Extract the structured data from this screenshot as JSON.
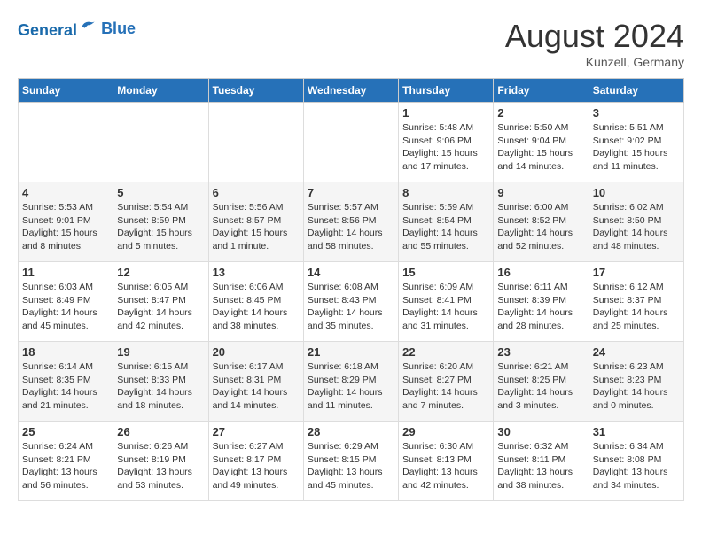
{
  "header": {
    "logo_line1": "General",
    "logo_line2": "Blue",
    "month_title": "August 2024",
    "location": "Kunzell, Germany"
  },
  "weekdays": [
    "Sunday",
    "Monday",
    "Tuesday",
    "Wednesday",
    "Thursday",
    "Friday",
    "Saturday"
  ],
  "weeks": [
    [
      {
        "day": "",
        "info": ""
      },
      {
        "day": "",
        "info": ""
      },
      {
        "day": "",
        "info": ""
      },
      {
        "day": "",
        "info": ""
      },
      {
        "day": "1",
        "info": "Sunrise: 5:48 AM\nSunset: 9:06 PM\nDaylight: 15 hours\nand 17 minutes."
      },
      {
        "day": "2",
        "info": "Sunrise: 5:50 AM\nSunset: 9:04 PM\nDaylight: 15 hours\nand 14 minutes."
      },
      {
        "day": "3",
        "info": "Sunrise: 5:51 AM\nSunset: 9:02 PM\nDaylight: 15 hours\nand 11 minutes."
      }
    ],
    [
      {
        "day": "4",
        "info": "Sunrise: 5:53 AM\nSunset: 9:01 PM\nDaylight: 15 hours\nand 8 minutes."
      },
      {
        "day": "5",
        "info": "Sunrise: 5:54 AM\nSunset: 8:59 PM\nDaylight: 15 hours\nand 5 minutes."
      },
      {
        "day": "6",
        "info": "Sunrise: 5:56 AM\nSunset: 8:57 PM\nDaylight: 15 hours\nand 1 minute."
      },
      {
        "day": "7",
        "info": "Sunrise: 5:57 AM\nSunset: 8:56 PM\nDaylight: 14 hours\nand 58 minutes."
      },
      {
        "day": "8",
        "info": "Sunrise: 5:59 AM\nSunset: 8:54 PM\nDaylight: 14 hours\nand 55 minutes."
      },
      {
        "day": "9",
        "info": "Sunrise: 6:00 AM\nSunset: 8:52 PM\nDaylight: 14 hours\nand 52 minutes."
      },
      {
        "day": "10",
        "info": "Sunrise: 6:02 AM\nSunset: 8:50 PM\nDaylight: 14 hours\nand 48 minutes."
      }
    ],
    [
      {
        "day": "11",
        "info": "Sunrise: 6:03 AM\nSunset: 8:49 PM\nDaylight: 14 hours\nand 45 minutes."
      },
      {
        "day": "12",
        "info": "Sunrise: 6:05 AM\nSunset: 8:47 PM\nDaylight: 14 hours\nand 42 minutes."
      },
      {
        "day": "13",
        "info": "Sunrise: 6:06 AM\nSunset: 8:45 PM\nDaylight: 14 hours\nand 38 minutes."
      },
      {
        "day": "14",
        "info": "Sunrise: 6:08 AM\nSunset: 8:43 PM\nDaylight: 14 hours\nand 35 minutes."
      },
      {
        "day": "15",
        "info": "Sunrise: 6:09 AM\nSunset: 8:41 PM\nDaylight: 14 hours\nand 31 minutes."
      },
      {
        "day": "16",
        "info": "Sunrise: 6:11 AM\nSunset: 8:39 PM\nDaylight: 14 hours\nand 28 minutes."
      },
      {
        "day": "17",
        "info": "Sunrise: 6:12 AM\nSunset: 8:37 PM\nDaylight: 14 hours\nand 25 minutes."
      }
    ],
    [
      {
        "day": "18",
        "info": "Sunrise: 6:14 AM\nSunset: 8:35 PM\nDaylight: 14 hours\nand 21 minutes."
      },
      {
        "day": "19",
        "info": "Sunrise: 6:15 AM\nSunset: 8:33 PM\nDaylight: 14 hours\nand 18 minutes."
      },
      {
        "day": "20",
        "info": "Sunrise: 6:17 AM\nSunset: 8:31 PM\nDaylight: 14 hours\nand 14 minutes."
      },
      {
        "day": "21",
        "info": "Sunrise: 6:18 AM\nSunset: 8:29 PM\nDaylight: 14 hours\nand 11 minutes."
      },
      {
        "day": "22",
        "info": "Sunrise: 6:20 AM\nSunset: 8:27 PM\nDaylight: 14 hours\nand 7 minutes."
      },
      {
        "day": "23",
        "info": "Sunrise: 6:21 AM\nSunset: 8:25 PM\nDaylight: 14 hours\nand 3 minutes."
      },
      {
        "day": "24",
        "info": "Sunrise: 6:23 AM\nSunset: 8:23 PM\nDaylight: 14 hours\nand 0 minutes."
      }
    ],
    [
      {
        "day": "25",
        "info": "Sunrise: 6:24 AM\nSunset: 8:21 PM\nDaylight: 13 hours\nand 56 minutes."
      },
      {
        "day": "26",
        "info": "Sunrise: 6:26 AM\nSunset: 8:19 PM\nDaylight: 13 hours\nand 53 minutes."
      },
      {
        "day": "27",
        "info": "Sunrise: 6:27 AM\nSunset: 8:17 PM\nDaylight: 13 hours\nand 49 minutes."
      },
      {
        "day": "28",
        "info": "Sunrise: 6:29 AM\nSunset: 8:15 PM\nDaylight: 13 hours\nand 45 minutes."
      },
      {
        "day": "29",
        "info": "Sunrise: 6:30 AM\nSunset: 8:13 PM\nDaylight: 13 hours\nand 42 minutes."
      },
      {
        "day": "30",
        "info": "Sunrise: 6:32 AM\nSunset: 8:11 PM\nDaylight: 13 hours\nand 38 minutes."
      },
      {
        "day": "31",
        "info": "Sunrise: 6:34 AM\nSunset: 8:08 PM\nDaylight: 13 hours\nand 34 minutes."
      }
    ]
  ]
}
